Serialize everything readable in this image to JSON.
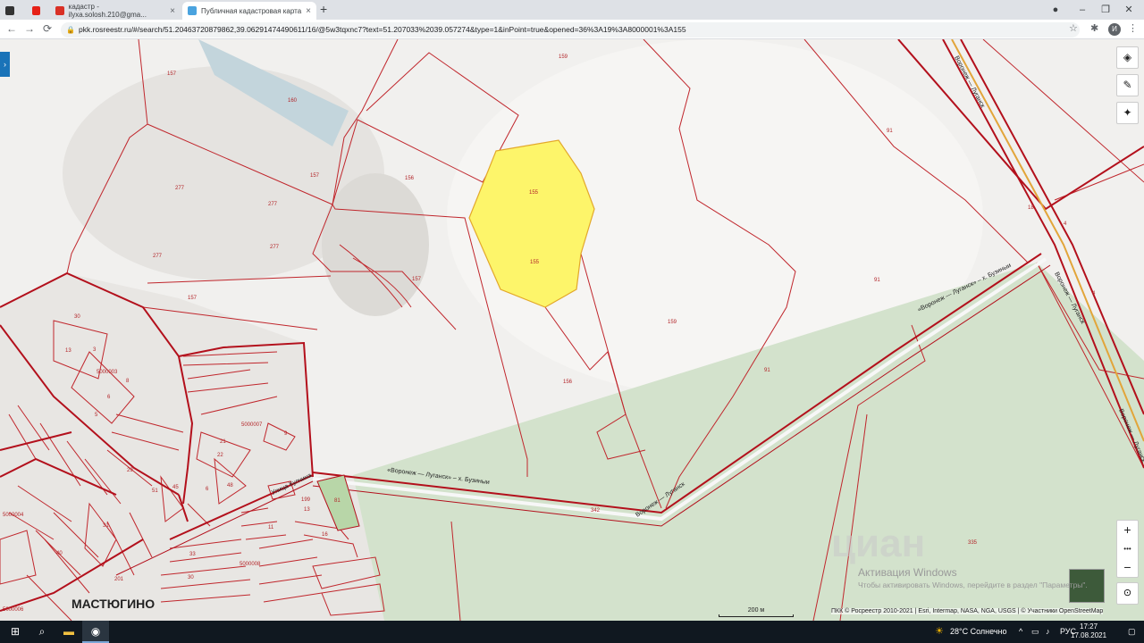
{
  "browser": {
    "tabs": [
      {
        "label": "кадастр - ilyxa.solosh.210@gma...",
        "close": "×"
      },
      {
        "label": "Публичная кадастровая карта",
        "close": "×"
      }
    ],
    "new_tab": "+",
    "url": "pkk.rosreestr.ru/#/search/51.20463720879862,39.06291474490611/16/@5w3tqxnc7?text=51.207033%2039.057274&type=1&inPoint=true&opened=36%3A19%3A8000001%3A155",
    "avatar_letter": "И",
    "window_controls": {
      "minimize": "–",
      "restore": "❐",
      "close": "✕"
    },
    "nav": {
      "back": "←",
      "forward": "→",
      "reload": "⟳"
    }
  },
  "map": {
    "parcel_labels": [
      "157",
      "160",
      "159",
      "156",
      "155",
      "155",
      "277",
      "277",
      "277",
      "277",
      "157",
      "157",
      "157",
      "91",
      "91",
      "159",
      "91",
      "156",
      "4",
      "4",
      "18",
      "30",
      "13",
      "3",
      "8",
      "6",
      "5",
      "29",
      "5000003",
      "5000007",
      "9",
      "21",
      "22",
      "48",
      "45",
      "51",
      "6",
      "5000004",
      "31",
      "40",
      "11",
      "5000008",
      "199",
      "13",
      "16",
      "81",
      "342",
      "335",
      "201",
      "33",
      "30",
      "5000006"
    ],
    "road_labels": [
      "Воронеж — Луганск",
      "«Воронеж — Луганск» – х. Бузиныи",
      "«Воронеж — Луганск» – х. Бузиныи",
      "Воронеж — Луганск",
      "Улица Кулчина",
      "Воронеж — Луганск",
      "Воронеж — Луганск"
    ],
    "highlight_color": "#fdf56a",
    "border_color": "#c0262c",
    "forest_color": "#d3e2cc",
    "village_name": "МАСТЮГИНО",
    "scale_label": "200 м",
    "attribution": "ПКК © Росреестр 2010-2021 | Esri, Intermap, NASA, NGA, USGS | © Участники OpenStreetMap",
    "watermark_title": "Активация Windows",
    "watermark_sub": "Чтобы активировать Windows, перейдите в раздел \"Параметры\".",
    "brand_watermark": "циан",
    "controls": {
      "layers": "◈",
      "ruler": "✎",
      "locate": "✦",
      "zoom_in": "+",
      "more": "•••",
      "zoom_out": "−",
      "compass": "⊙",
      "panel_toggle": "›"
    }
  },
  "taskbar": {
    "weather": "28°C Солнечно",
    "lang": "РУС",
    "time": "17:27",
    "date": "17.08.2021"
  }
}
